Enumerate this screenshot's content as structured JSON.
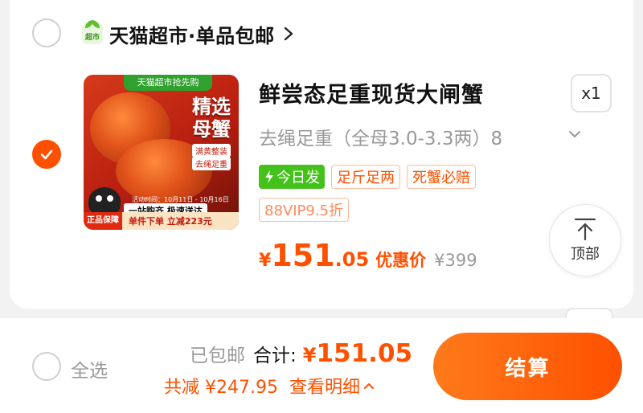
{
  "shop": {
    "logo_text": "超市",
    "name": "天猫超市·单品包邮"
  },
  "item": {
    "thumbnail": {
      "top_band": "天猫超市抢先购",
      "title_line1": "精选",
      "title_line2": "母蟹",
      "tag1": "满黄整装",
      "tag2": "去绳足重",
      "dateline": "活动时间：10月11日 - 10月16日",
      "slogan": "一站购齐 极速送达",
      "guarantee": "正品保障",
      "promo": "单件下单 立减223元"
    },
    "title": "鲜尝态足重现货大闸蟹",
    "quantity": "x1",
    "sku": "去绳足重（全母3.0-3.3两）8",
    "tags": {
      "green": "今日发",
      "t1": "足斤足两",
      "t2": "死蟹必赔",
      "vip": "88VIP9.5折"
    },
    "price": {
      "yen": "¥",
      "int": "151",
      "dec": ".05",
      "label": "优惠价",
      "original": "¥399"
    }
  },
  "top_button": {
    "label": "顶部"
  },
  "bottom": {
    "select_all": "全选",
    "free_shipping": "已包邮",
    "total_label": "合计:",
    "total_yen": "¥",
    "total_value": "151.05",
    "saved": "共减 ¥247.95",
    "detail": "查看明细",
    "checkout": "结算"
  },
  "colors": {
    "accent": "#ff5000",
    "green_tag": "#45c11b"
  }
}
